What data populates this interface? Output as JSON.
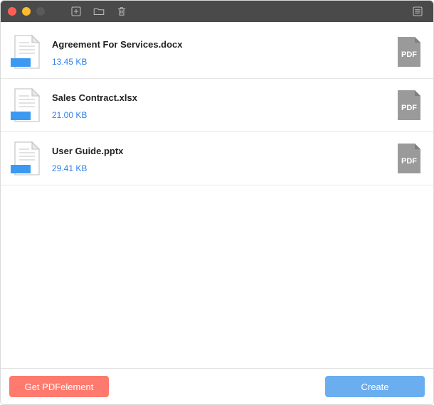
{
  "colors": {
    "accent_blue": "#2f80ed",
    "button_red": "#ff7a6e",
    "button_blue": "#6aaef0",
    "titlebar": "#4a4a4a",
    "pdf_gray": "#9a9a9a"
  },
  "titlebar": {
    "add_icon": "add-file-icon",
    "folder_icon": "folder-icon",
    "trash_icon": "trash-icon",
    "menu_icon": "list-icon"
  },
  "files": [
    {
      "name": "Agreement For Services.docx",
      "size": "13.45 KB",
      "output_label": "PDF"
    },
    {
      "name": "Sales Contract.xlsx",
      "size": "21.00 KB",
      "output_label": "PDF"
    },
    {
      "name": "User Guide.pptx",
      "size": "29.41 KB",
      "output_label": "PDF"
    }
  ],
  "footer": {
    "get_label": "Get PDFelement",
    "create_label": "Create"
  }
}
